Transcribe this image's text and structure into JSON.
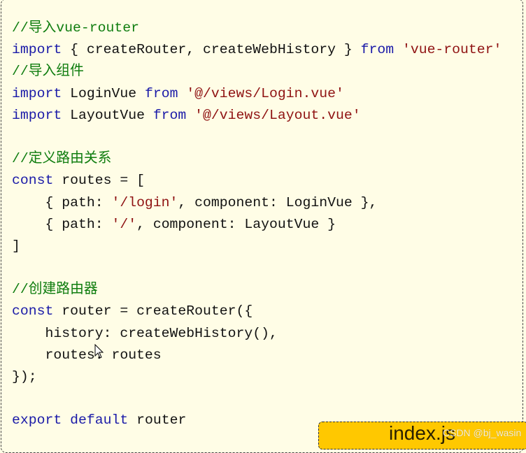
{
  "colors": {
    "comment": "#0f7d0f",
    "keyword": "#1a1aa8",
    "string": "#8f1212",
    "background": "#fffde6",
    "tab": "#ffc800"
  },
  "code": [
    [
      [
        "c",
        "//导入vue-router"
      ]
    ],
    [
      [
        "k",
        "import"
      ],
      [
        "p",
        " { createRouter, createWebHistory } "
      ],
      [
        "k",
        "from"
      ],
      [
        "p",
        " "
      ],
      [
        "s",
        "'vue-router'"
      ]
    ],
    [
      [
        "c",
        "//导入组件"
      ]
    ],
    [
      [
        "k",
        "import"
      ],
      [
        "p",
        " LoginVue "
      ],
      [
        "k",
        "from"
      ],
      [
        "p",
        " "
      ],
      [
        "s",
        "'@/views/Login.vue'"
      ]
    ],
    [
      [
        "k",
        "import"
      ],
      [
        "p",
        " LayoutVue "
      ],
      [
        "k",
        "from"
      ],
      [
        "p",
        " "
      ],
      [
        "s",
        "'@/views/Layout.vue'"
      ]
    ],
    [],
    [
      [
        "c",
        "//定义路由关系"
      ]
    ],
    [
      [
        "k",
        "const"
      ],
      [
        "p",
        " routes = ["
      ]
    ],
    [
      [
        "p",
        "    { path: "
      ],
      [
        "s",
        "'/login'"
      ],
      [
        "p",
        ", component: LoginVue },"
      ]
    ],
    [
      [
        "p",
        "    { path: "
      ],
      [
        "s",
        "'/'"
      ],
      [
        "p",
        ", component: LayoutVue }"
      ]
    ],
    [
      [
        "p",
        "]"
      ]
    ],
    [],
    [
      [
        "c",
        "//创建路由器"
      ]
    ],
    [
      [
        "k",
        "const"
      ],
      [
        "p",
        " router = createRouter({"
      ]
    ],
    [
      [
        "p",
        "    history: createWebHistory(),"
      ]
    ],
    [
      [
        "p",
        "    routes: routes"
      ]
    ],
    [
      [
        "p",
        "});"
      ]
    ],
    [],
    [
      [
        "k",
        "export"
      ],
      [
        "p",
        " "
      ],
      [
        "k",
        "default"
      ],
      [
        "p",
        " router"
      ]
    ]
  ],
  "file_tab": {
    "label": "index.js"
  },
  "watermark": "CSDN @bj_wasin",
  "icons": {
    "cursor": "mouse-pointer-icon"
  }
}
